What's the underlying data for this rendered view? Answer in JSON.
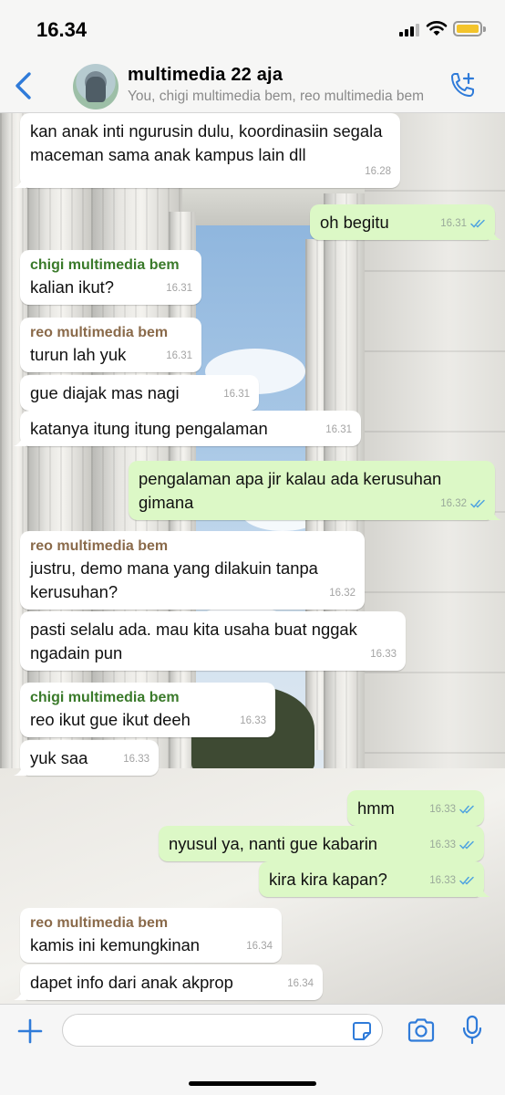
{
  "status_bar": {
    "time": "16.34"
  },
  "header": {
    "title": "multimedia 22 aja",
    "subtitle": "You, chigi multimedia bem, reo multimedia bem"
  },
  "colors": {
    "accent": "#2f7bd9",
    "bubble_in": "#ffffff",
    "bubble_out": "#dcf8c6",
    "sender_chigi": "#3a7a2a",
    "sender_reo": "#8a6a4a",
    "read_ticks": "#4fa3e0"
  },
  "messages": [
    {
      "dir": "in",
      "text": "kan anak inti ngurusin dulu, koordinasiin segala maceman sama anak kampus lain dll",
      "time": "16.28"
    },
    {
      "dir": "out",
      "text": "oh begitu",
      "time": "16.31"
    },
    {
      "dir": "in",
      "sender": "chigi multimedia bem",
      "text": "kalian ikut?",
      "time": "16.31"
    },
    {
      "dir": "in",
      "sender": "reo multimedia bem",
      "text": "turun lah yuk",
      "time": "16.31"
    },
    {
      "dir": "in",
      "text": "gue diajak mas nagi",
      "time": "16.31"
    },
    {
      "dir": "in",
      "text": "katanya itung itung pengalaman",
      "time": "16.31"
    },
    {
      "dir": "out",
      "text": "pengalaman apa jir kalau ada kerusuhan gimana",
      "time": "16.32"
    },
    {
      "dir": "in",
      "sender": "reo multimedia bem",
      "text": "justru, demo mana yang dilakuin tanpa kerusuhan?",
      "time": "16.32"
    },
    {
      "dir": "in",
      "text": "pasti selalu ada. mau kita usaha buat nggak ngadain pun",
      "time": "16.33"
    },
    {
      "dir": "in",
      "sender": "chigi multimedia bem",
      "text": "reo ikut gue ikut deeh",
      "time": "16.33"
    },
    {
      "dir": "in",
      "text": "yuk saa",
      "time": "16.33"
    },
    {
      "dir": "out",
      "text": "hmm",
      "time": "16.33"
    },
    {
      "dir": "out",
      "text": "nyusul ya, nanti gue kabarin",
      "time": "16.33"
    },
    {
      "dir": "out",
      "text": "kira kira kapan?",
      "time": "16.33"
    },
    {
      "dir": "in",
      "sender": "reo multimedia bem",
      "text": "kamis ini kemungkinan",
      "time": "16.34"
    },
    {
      "dir": "in",
      "text": "dapet info dari anak akprop",
      "time": "16.34"
    }
  ],
  "icons": {
    "back": "chevron-left-icon",
    "add_call": "phone-plus-icon",
    "attach": "plus-icon",
    "sticker": "sticker-icon",
    "camera": "camera-icon",
    "mic": "microphone-icon"
  }
}
